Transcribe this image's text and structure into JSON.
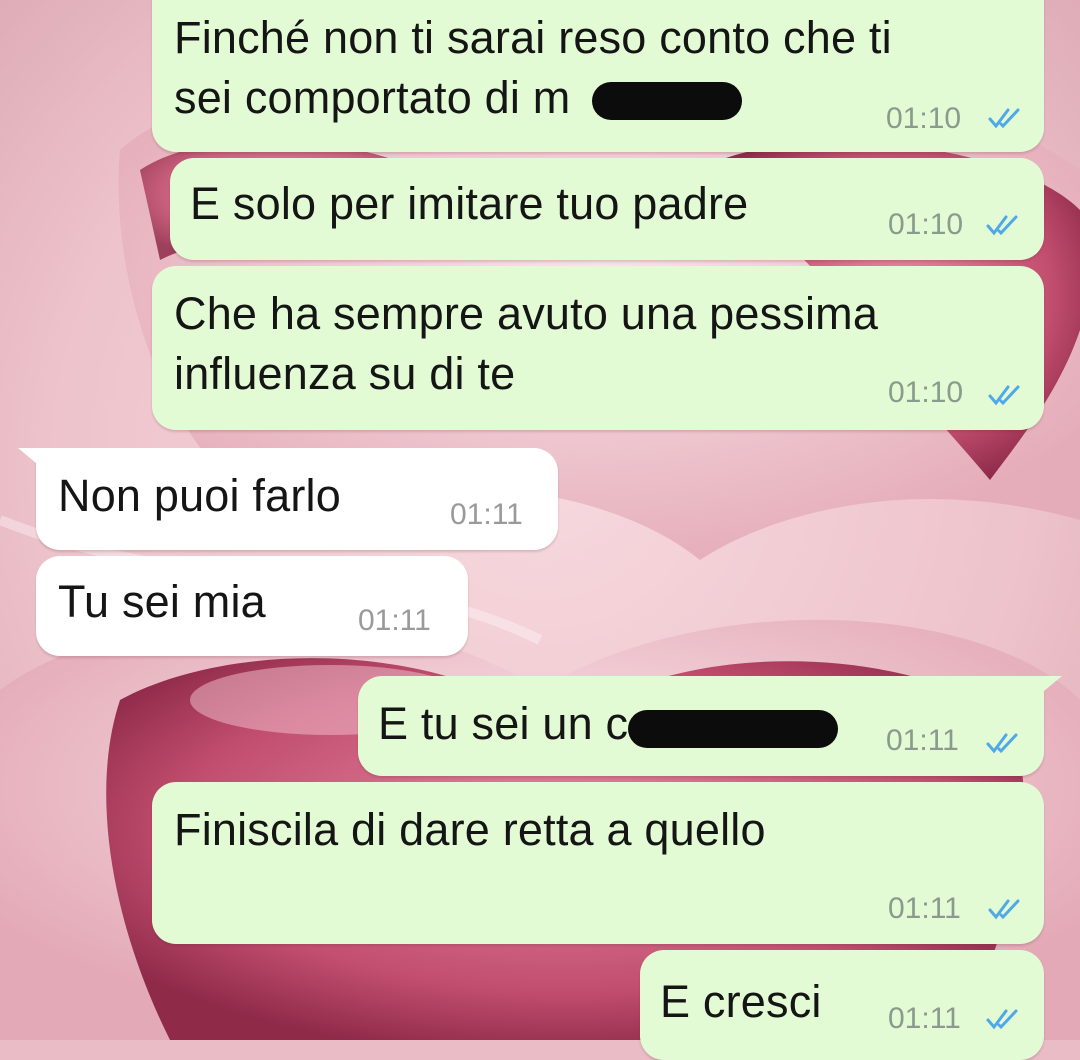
{
  "conversation": {
    "messages": [
      {
        "id": "m1",
        "direction": "outgoing",
        "text_lines": [
          "Finché non ti sarai reso conto che ti",
          "sei comportato di m"
        ],
        "time": "01:10",
        "status": "read"
      },
      {
        "id": "m2",
        "direction": "outgoing",
        "text_lines": [
          "E solo per imitare tuo padre"
        ],
        "time": "01:10",
        "status": "read"
      },
      {
        "id": "m3",
        "direction": "outgoing",
        "text_lines": [
          "Che ha sempre avuto una pessima",
          "influenza su di te"
        ],
        "time": "01:10",
        "status": "read"
      },
      {
        "id": "m4",
        "direction": "incoming",
        "text_lines": [
          "Non puoi farlo"
        ],
        "time": "01:11"
      },
      {
        "id": "m5",
        "direction": "incoming",
        "text_lines": [
          "Tu sei mia"
        ],
        "time": "01:11"
      },
      {
        "id": "m6",
        "direction": "outgoing",
        "text_lines": [
          "E tu sei un c"
        ],
        "time": "01:11",
        "status": "read"
      },
      {
        "id": "m7",
        "direction": "outgoing",
        "text_lines": [
          "Finiscila di dare retta a quello"
        ],
        "time": "01:11",
        "status": "read"
      },
      {
        "id": "m8",
        "direction": "outgoing",
        "text_lines": [
          "E cresci"
        ],
        "time": "01:11",
        "status": "read"
      }
    ]
  },
  "colors": {
    "outgoing_bubble": "#e3fbd5",
    "incoming_bubble": "#ffffff",
    "read_ticks": "#4fa8e8",
    "wallpaper_base": "#e9bcc6",
    "wallpaper_heart": "#c44b6e"
  },
  "icons": {
    "read_receipt": "double-check-icon"
  }
}
